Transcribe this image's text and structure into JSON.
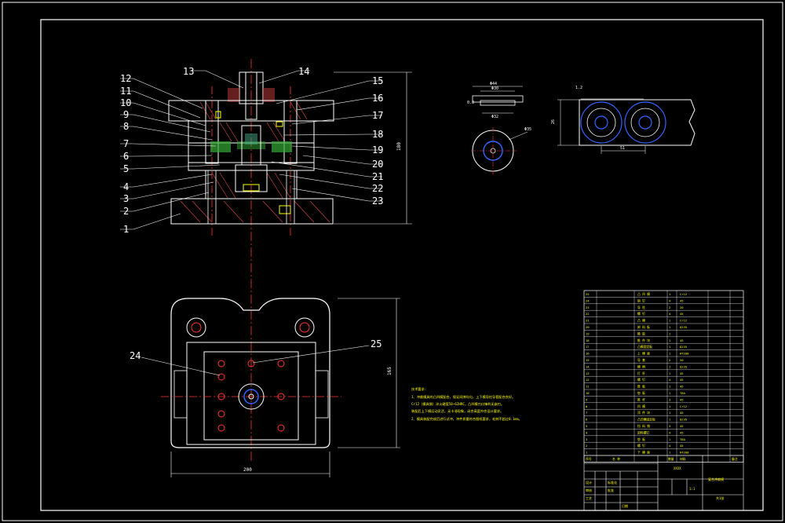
{
  "drawing": {
    "balloons_left": [
      "12",
      "11",
      "10",
      "9",
      "8",
      "7",
      "6",
      "5",
      "4",
      "3",
      "2",
      "1"
    ],
    "balloons_right": [
      "15",
      "16",
      "17",
      "18",
      "19",
      "20",
      "21",
      "22",
      "23"
    ],
    "balloon_top_left": "13",
    "balloon_top_right": "14",
    "balloon_plan_left": "24",
    "balloon_plan_right": "25",
    "dim_height": "180",
    "dim_plan_width": "200",
    "dim_plan_height": "165",
    "part_dims": [
      "Φ44",
      "Φ30",
      "0.8",
      "Φ32",
      "Φ35"
    ],
    "strip_dims": [
      "1.2",
      "26",
      "51"
    ],
    "tech_title": "技术要求:",
    "tech_lines": [
      "1、冲裁模具的凸凹模配合，保证间隙均匀，上下模导柱导套配合良好。",
      "Cr12（模具钢）淬火硬度58~62HRC，凸凹模刃口锋利无崩刃。",
      "装配后上下模运动灵活，无卡滞现象，闭合高度符合设计要求。",
      "2、模具装配完成后进行试冲，冲件质量符合图纸要求，毛刺不超过0.1mm。"
    ],
    "bom_rows": [
      {
        "no": "25",
        "name": "凸 凹 模",
        "qty": "1",
        "mat": "Cr12"
      },
      {
        "no": "24",
        "name": "销 钉",
        "qty": "4",
        "mat": "45"
      },
      {
        "no": "23",
        "name": "导 柱",
        "qty": "2",
        "mat": "20"
      },
      {
        "no": "22",
        "name": "螺 钉",
        "qty": "4",
        "mat": "45"
      },
      {
        "no": "21",
        "name": "凸 模",
        "qty": "1",
        "mat": "Cr12"
      },
      {
        "no": "20",
        "name": "卸 料 板",
        "qty": "1",
        "mat": "Q235"
      },
      {
        "no": "19",
        "name": "橡 胶",
        "qty": "1",
        "mat": ""
      },
      {
        "no": "18",
        "name": "推 件 块",
        "qty": "1",
        "mat": "45"
      },
      {
        "no": "17",
        "name": "凸模固定板",
        "qty": "1",
        "mat": "Q235"
      },
      {
        "no": "16",
        "name": "上 模 座",
        "qty": "1",
        "mat": "HT200"
      },
      {
        "no": "15",
        "name": "导 套",
        "qty": "2",
        "mat": "20"
      },
      {
        "no": "14",
        "name": "模 柄",
        "qty": "1",
        "mat": "Q235"
      },
      {
        "no": "13",
        "name": "打 杆",
        "qty": "1",
        "mat": "45"
      },
      {
        "no": "12",
        "name": "螺 钉",
        "qty": "4",
        "mat": "45"
      },
      {
        "no": "11",
        "name": "推 板",
        "qty": "1",
        "mat": "45"
      },
      {
        "no": "10",
        "name": "垫 板",
        "qty": "1",
        "mat": "T8A"
      },
      {
        "no": "9",
        "name": "推 杆",
        "qty": "3",
        "mat": "45"
      },
      {
        "no": "8",
        "name": "凹 模",
        "qty": "1",
        "mat": "Cr12"
      },
      {
        "no": "7",
        "name": "顶 件 块",
        "qty": "1",
        "mat": "45"
      },
      {
        "no": "6",
        "name": "凸凹模固定板",
        "qty": "1",
        "mat": "Q235"
      },
      {
        "no": "5",
        "name": "挡 料 销",
        "qty": "3",
        "mat": "45"
      },
      {
        "no": "4",
        "name": "卸料螺钉",
        "qty": "4",
        "mat": "45"
      },
      {
        "no": "3",
        "name": "垫 板",
        "qty": "1",
        "mat": "T8A"
      },
      {
        "no": "2",
        "name": "螺 钉",
        "qty": "4",
        "mat": "45"
      },
      {
        "no": "1",
        "name": "下 模 座",
        "qty": "1",
        "mat": "HT200"
      }
    ],
    "bom_header": [
      "序号",
      "名 称",
      "数量",
      "材料",
      "备注"
    ],
    "title_block": {
      "drawing_name": "复合冲裁模",
      "school": "XXXX",
      "scale": "1:1",
      "sheet": "共1张",
      "labels": [
        "设计",
        "审核",
        "工艺",
        "标准化",
        "批准",
        "日期"
      ]
    }
  }
}
